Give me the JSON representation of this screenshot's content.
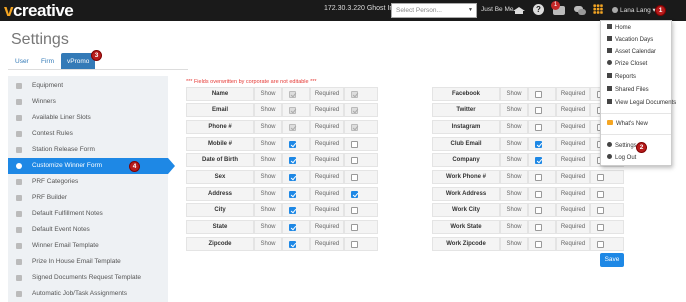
{
  "header": {
    "logo_v": "v",
    "logo_rest": "creative",
    "ip_text": "172.30.3.220",
    "ghost_label": "Ghost In As:",
    "person_placeholder": "Select Person...",
    "just_be_me": "Just Be Me",
    "notification_count": "1",
    "user_name": "Lana Lang"
  },
  "page": {
    "title": "Settings",
    "tabs": [
      "User",
      "Firm",
      "vPromo"
    ],
    "active_tab": "vPromo",
    "note": "*** Fields overwritten by corporate are not editable ***",
    "save_label": "Save"
  },
  "sidebar": {
    "items": [
      "Equipment",
      "Winners",
      "Available Liner Slots",
      "Contest Rules",
      "Station Release Form",
      "Customize Winner Form",
      "PRF Categories",
      "PRF Builder",
      "Default Fulfillment Notes",
      "Default Event Notes",
      "Winner Email Template",
      "Prize In House Email Template",
      "Signed Documents Request Template",
      "Automatic Job/Task Assignments"
    ],
    "active_index": 5
  },
  "form": {
    "show_label": "Show",
    "required_label": "Required",
    "left_fields": [
      {
        "name": "Name",
        "show": true,
        "required": true,
        "locked": true
      },
      {
        "name": "Email",
        "show": true,
        "required": true,
        "locked": true
      },
      {
        "name": "Phone #",
        "show": true,
        "required": true,
        "locked": true
      },
      {
        "name": "Mobile #",
        "show": true,
        "required": false,
        "locked": false
      },
      {
        "name": "Date of Birth",
        "show": true,
        "required": false,
        "locked": false
      },
      {
        "name": "Sex",
        "show": true,
        "required": false,
        "locked": false
      },
      {
        "name": "Address",
        "show": true,
        "required": true,
        "locked": false
      },
      {
        "name": "City",
        "show": true,
        "required": false,
        "locked": false
      },
      {
        "name": "State",
        "show": true,
        "required": false,
        "locked": false
      },
      {
        "name": "Zipcode",
        "show": true,
        "required": false,
        "locked": false
      }
    ],
    "right_fields": [
      {
        "name": "Facebook",
        "show": false,
        "required": false
      },
      {
        "name": "Twitter",
        "show": false,
        "required": false
      },
      {
        "name": "Instagram",
        "show": false,
        "required": false
      },
      {
        "name": "Club Email",
        "show": true,
        "required": false
      },
      {
        "name": "Company",
        "show": true,
        "required": false
      },
      {
        "name": "Work Phone #",
        "show": false,
        "required": false
      },
      {
        "name": "Work Address",
        "show": false,
        "required": false
      },
      {
        "name": "Work City",
        "show": false,
        "required": false
      },
      {
        "name": "Work State",
        "show": false,
        "required": false
      },
      {
        "name": "Work Zipcode",
        "show": false,
        "required": false
      }
    ]
  },
  "user_menu": {
    "items": [
      {
        "label": "Home",
        "icon": "home-icon"
      },
      {
        "label": "Vacation Days",
        "icon": "calendar-icon"
      },
      {
        "label": "Asset Calendar",
        "icon": "calendar-icon"
      },
      {
        "label": "Prize Closet",
        "icon": "clock-icon"
      },
      {
        "label": "Reports",
        "icon": "file-icon"
      },
      {
        "label": "Shared Files",
        "icon": "folder-icon"
      },
      {
        "label": "View Legal Documents",
        "icon": "folder-icon"
      },
      {
        "label": "What's New",
        "icon": "news-icon"
      },
      {
        "label": "Settings",
        "icon": "gear-icon"
      },
      {
        "label": "Log Out",
        "icon": "power-icon"
      }
    ]
  },
  "badges": [
    "1",
    "2",
    "3",
    "4"
  ],
  "colors": {
    "accent": "#1e88e5",
    "brand_orange": "#f5a623",
    "badge_red": "#b71c1c",
    "topbar": "#1a1a1a",
    "note_red": "#e53935"
  }
}
